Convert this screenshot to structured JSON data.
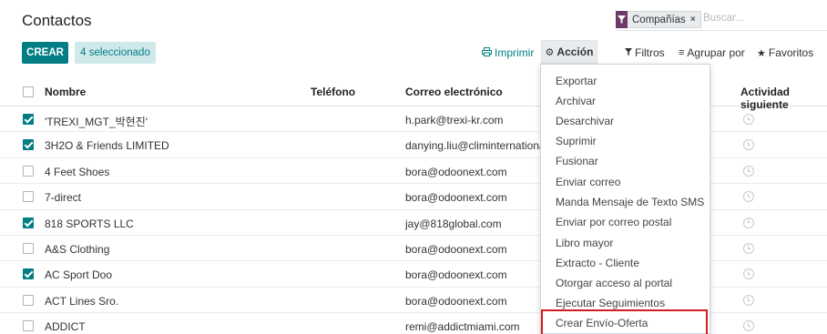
{
  "page": {
    "title": "Contactos"
  },
  "buttons": {
    "create": "CREAR",
    "selected": "4 seleccionado"
  },
  "search": {
    "facet_label": "Compañías",
    "facet_remove": "×",
    "placeholder": "Buscar..."
  },
  "toolbar": {
    "print": "Imprimir",
    "action": "Acción",
    "filters": "Filtros",
    "group_by": "Agrupar por",
    "favorites": "Favoritos"
  },
  "table": {
    "headers": {
      "name": "Nombre",
      "phone": "Teléfono",
      "email": "Correo electrónico",
      "next_activity": "Actividad siguiente"
    },
    "rows": [
      {
        "name": "'TREXI_MGT_박현진'",
        "email": "h.park@trexi-kr.com",
        "checked": true
      },
      {
        "name": "3H2O & Friends LIMITED",
        "email": "danying.liu@climinternationa",
        "checked": true
      },
      {
        "name": "4 Feet Shoes",
        "email": "bora@odoonext.com",
        "checked": false
      },
      {
        "name": "7-direct",
        "email": "bora@odoonext.com",
        "checked": false
      },
      {
        "name": "818 SPORTS LLC",
        "email": "jay@818global.com",
        "checked": true
      },
      {
        "name": "A&S Clothing",
        "email": "bora@odoonext.com",
        "checked": false
      },
      {
        "name": "AC Sport Doo",
        "email": "bora@odoonext.com",
        "checked": true
      },
      {
        "name": "ACT Lines Sro.",
        "email": "bora@odoonext.com",
        "checked": false
      },
      {
        "name": "ADDICT",
        "email": "remi@addictmiami.com",
        "checked": false
      }
    ]
  },
  "action_menu": {
    "items": [
      "Exportar",
      "Archivar",
      "Desarchivar",
      "Suprimir",
      "Fusionar",
      "Enviar correo",
      "Manda Mensaje de Texto SMS",
      "Enviar por correo postal",
      "Libro mayor",
      "Extracto - Cliente",
      "Otorgar acceso al portal",
      "Ejecutar Seguimientos",
      "Crear Envío-Oferta"
    ],
    "highlighted": "Crear Envío-Oferta"
  },
  "colors": {
    "primary": "#017e84",
    "highlight": "#d11f1f",
    "facet_icon": "#6c3a66"
  }
}
